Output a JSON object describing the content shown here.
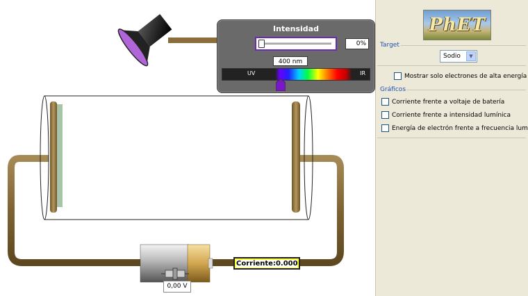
{
  "simulation": {
    "intensity_control": {
      "title": "Intensidad",
      "intensity_percent": "0%",
      "intensity_fraction": 0,
      "wavelength_value": "400 nm",
      "spectrum_left_label": "UV",
      "spectrum_right_label": "IR"
    },
    "current_display": "Corriente:0.000",
    "battery_voltage": "0,00 V"
  },
  "panel": {
    "logo_text": "PhET",
    "target": {
      "title": "Target",
      "selected": "Sodio"
    },
    "high_energy_checkbox": "Mostrar solo electrones de alta energía",
    "graphs": {
      "title": "Gráficos",
      "items": [
        "Corriente frente a voltaje de batería",
        "Corriente frente a intensidad lumínica",
        "Energía de electrón frente a frecuencia lumínica"
      ]
    }
  },
  "colors": {
    "spectrum_slider_border": "#6a2db2",
    "current_box": "#ffff33",
    "wire": "#8a6d3b",
    "group_title": "#1f4fb4"
  }
}
